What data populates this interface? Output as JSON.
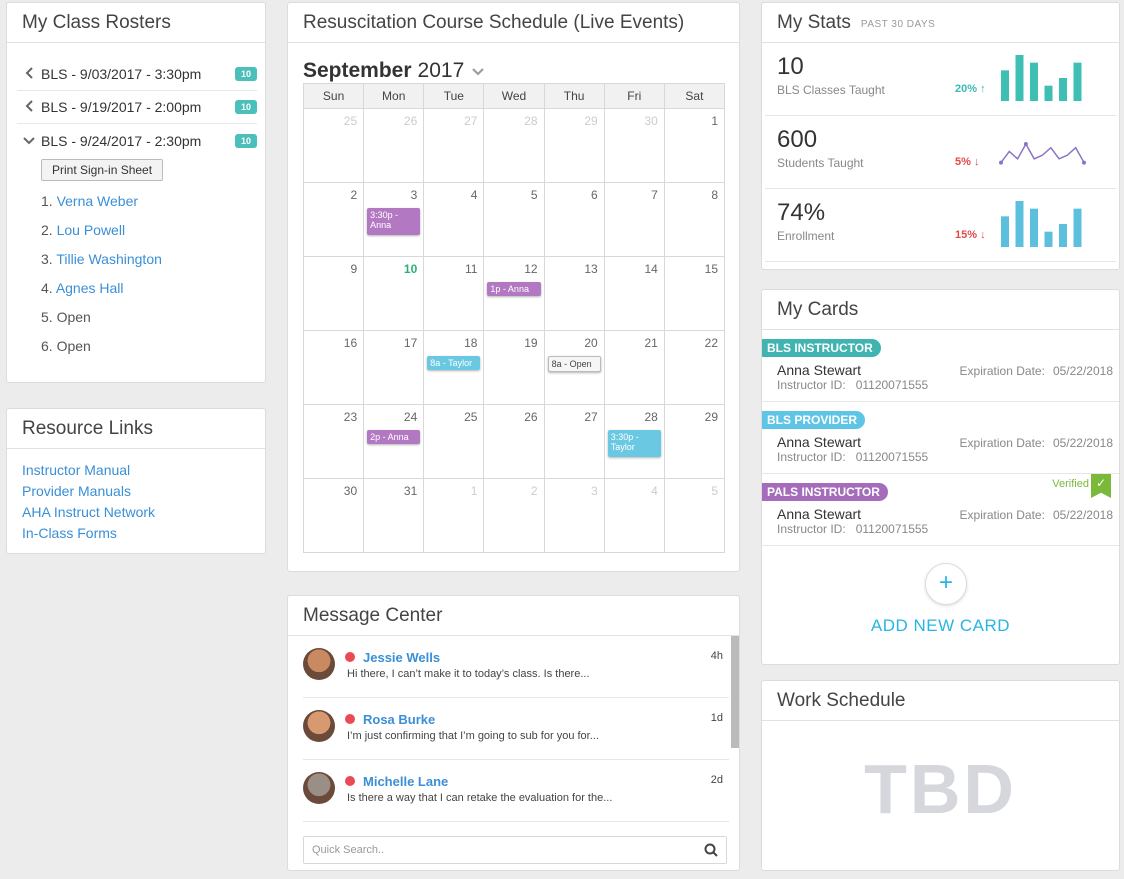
{
  "rosters": {
    "title": "My Class Rosters",
    "items": [
      {
        "label": "BLS - 9/03/2017 - 3:30pm",
        "count": "10",
        "expanded": false
      },
      {
        "label": "BLS - 9/19/2017 - 2:00pm",
        "count": "10",
        "expanded": false
      },
      {
        "label": "BLS - 9/24/2017 - 2:30pm",
        "count": "10",
        "expanded": true
      }
    ],
    "print_label": "Print Sign-in Sheet",
    "attendees": [
      {
        "num": "1.",
        "name": "Verna Weber",
        "link": true
      },
      {
        "num": "2.",
        "name": "Lou Powell",
        "link": true
      },
      {
        "num": "3.",
        "name": "Tillie Washington",
        "link": true
      },
      {
        "num": "4.",
        "name": "Agnes Hall",
        "link": true
      },
      {
        "num": "5.",
        "name": "Open",
        "link": false
      },
      {
        "num": "6.",
        "name": "Open",
        "link": false
      }
    ]
  },
  "resources": {
    "title": "Resource Links",
    "links": [
      "Instructor Manual",
      "Provider Manuals",
      "AHA Instruct Network",
      "In-Class Forms"
    ]
  },
  "schedule": {
    "title": "Resuscitation Course Schedule (Live Events)",
    "month": "September",
    "year": "2017",
    "days": [
      "Sun",
      "Mon",
      "Tue",
      "Wed",
      "Thu",
      "Fri",
      "Sat"
    ],
    "weeks": [
      [
        {
          "d": "25",
          "m": true
        },
        {
          "d": "26",
          "m": true
        },
        {
          "d": "27",
          "m": true
        },
        {
          "d": "28",
          "m": true
        },
        {
          "d": "29",
          "m": true
        },
        {
          "d": "30",
          "m": true
        },
        {
          "d": "1"
        }
      ],
      [
        {
          "d": "2"
        },
        {
          "d": "3",
          "ev": {
            "text": "3:30p - Anna",
            "style": "purple",
            "tall": true
          }
        },
        {
          "d": "4"
        },
        {
          "d": "5"
        },
        {
          "d": "6"
        },
        {
          "d": "7"
        },
        {
          "d": "8"
        }
      ],
      [
        {
          "d": "9"
        },
        {
          "d": "10",
          "today": true
        },
        {
          "d": "11"
        },
        {
          "d": "12",
          "ev": {
            "text": "1p - Anna",
            "style": "purple"
          }
        },
        {
          "d": "13"
        },
        {
          "d": "14"
        },
        {
          "d": "15"
        }
      ],
      [
        {
          "d": "16"
        },
        {
          "d": "17"
        },
        {
          "d": "18",
          "ev": {
            "text": "8a - Taylor",
            "style": "blue"
          }
        },
        {
          "d": "19"
        },
        {
          "d": "20",
          "ev": {
            "text": "8a - Open",
            "style": "open"
          }
        },
        {
          "d": "21"
        },
        {
          "d": "22"
        }
      ],
      [
        {
          "d": "23"
        },
        {
          "d": "24",
          "ev": {
            "text": "2p - Anna",
            "style": "purple"
          }
        },
        {
          "d": "25"
        },
        {
          "d": "26"
        },
        {
          "d": "27"
        },
        {
          "d": "28",
          "ev": {
            "text": "3:30p - Taylor",
            "style": "blue",
            "tall": true
          }
        },
        {
          "d": "29"
        }
      ],
      [
        {
          "d": "30"
        },
        {
          "d": "31"
        },
        {
          "d": "1",
          "m": true
        },
        {
          "d": "2",
          "m": true
        },
        {
          "d": "3",
          "m": true
        },
        {
          "d": "4",
          "m": true
        },
        {
          "d": "5",
          "m": true
        }
      ]
    ]
  },
  "messages": {
    "title": "Message Center",
    "items": [
      {
        "name": "Jessie Wells",
        "text": "Hi there, I can’t make it to today’s class. Is there...",
        "time": "4h",
        "avatar_color": "#c98a62"
      },
      {
        "name": "Rosa Burke",
        "text": "I’m just confirming that I’m going to sub for you for...",
        "time": "1d",
        "avatar_color": "#d79a70"
      },
      {
        "name": "Michelle Lane",
        "text": "Is there a way that I can retake the evaluation for the...",
        "time": "2d",
        "avatar_color": "#9a8f86"
      }
    ],
    "search_placeholder": "Quick Search.."
  },
  "stats": {
    "title": "My Stats",
    "period": "PAST 30 DAYS",
    "items": [
      {
        "value": "10",
        "label": "BLS Classes Taught",
        "change": "20%",
        "direction": "up",
        "chart": "bar",
        "color": "#3fbfb3",
        "data": [
          4,
          6,
          5,
          2,
          3,
          5
        ]
      },
      {
        "value": "600",
        "label": "Students Taught",
        "change": "5%",
        "direction": "down",
        "chart": "line",
        "color": "#8a74c8",
        "data": [
          2,
          5,
          3,
          7,
          3,
          4,
          6,
          3,
          4,
          6,
          2
        ]
      },
      {
        "value": "74%",
        "label": "Enrollment",
        "change": "15%",
        "direction": "down",
        "chart": "bar",
        "color": "#5cbfdc",
        "data": [
          4,
          6,
          5,
          2,
          3,
          5
        ]
      }
    ]
  },
  "cards": {
    "title": "My Cards",
    "items": [
      {
        "tag": "BLS INSTRUCTOR",
        "tag_color": "teal",
        "name": "Anna Stewart",
        "id_label": "Instructor ID:",
        "id": "01120071555",
        "exp_label": "Expiration Date:",
        "exp": "05/22/2018",
        "verified": false
      },
      {
        "tag": "BLS PROVIDER",
        "tag_color": "sky",
        "name": "Anna Stewart",
        "id_label": "Instructor ID:",
        "id": "01120071555",
        "exp_label": "Expiration Date:",
        "exp": "05/22/2018",
        "verified": false
      },
      {
        "tag": "PALS INSTRUCTOR",
        "tag_color": "purple",
        "name": "Anna Stewart",
        "id_label": "Instructor ID:",
        "id": "01120071555",
        "exp_label": "Expiration Date:",
        "exp": "05/22/2018",
        "verified": true,
        "verified_label": "Verified"
      }
    ],
    "add_icon": "+",
    "add_label": "ADD NEW CARD"
  },
  "work": {
    "title": "Work Schedule",
    "placeholder": "TBD"
  }
}
